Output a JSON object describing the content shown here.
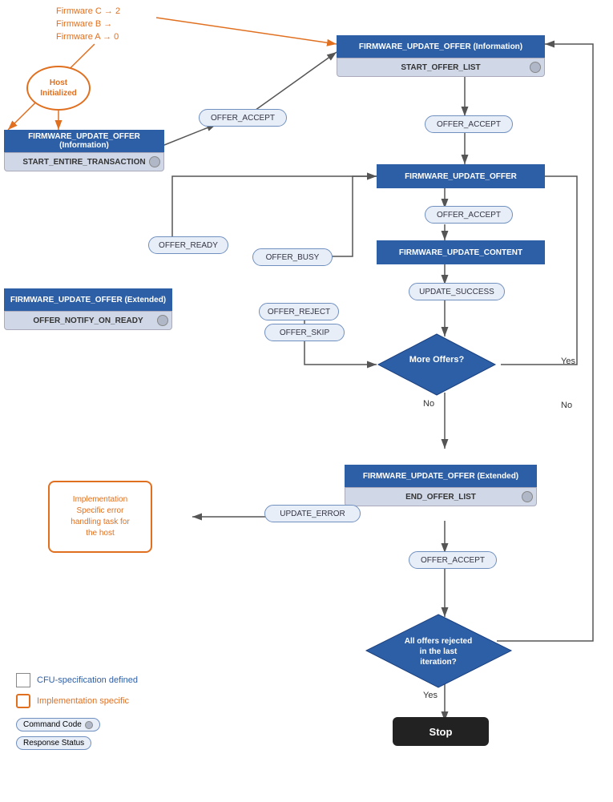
{
  "firmware": {
    "c": "Firmware C → 2",
    "b": "Firmware B →",
    "a": "Firmware A → 0"
  },
  "boxes": {
    "host_initialized": "Host\nInitialized",
    "fw_update_offer_info_top": "FIRMWARE_UPDATE_OFFER (Information)",
    "start_offer_list": "START_OFFER_LIST",
    "fw_update_offer_info_left": "FIRMWARE_UPDATE_OFFER (Information)",
    "start_entire_transaction": "START_ENTIRE_TRANSACTION",
    "fw_update_offer": "FIRMWARE_UPDATE_OFFER",
    "fw_update_content": "FIRMWARE_UPDATE_CONTENT",
    "fw_update_offer_extended_left": "FIRMWARE_UPDATE_OFFER (Extended)",
    "offer_notify_on_ready": "OFFER_NOTIFY_ON_READY",
    "fw_update_offer_extended_bottom": "FIRMWARE_UPDATE_OFFER (Extended)",
    "end_offer_list": "END_OFFER_LIST",
    "stop": "Stop"
  },
  "pills": {
    "offer_accept_top": "OFFER_ACCEPT",
    "offer_accept_mid": "OFFER_ACCEPT",
    "offer_accept_2": "OFFER_ACCEPT",
    "offer_accept_bottom": "OFFER_ACCEPT",
    "offer_ready": "OFFER_READY",
    "offer_busy": "OFFER_BUSY",
    "offer_reject": "OFFER_REJECT",
    "offer_skip": "OFFER_SKIP",
    "update_success": "UPDATE_SUCCESS",
    "update_error": "UPDATE_ERROR"
  },
  "diamonds": {
    "more_offers": "More Offers?",
    "all_offers_rejected": "All offers rejected\nin the last\niteration?"
  },
  "labels": {
    "yes_right": "Yes",
    "no_right": "No",
    "no_bottom": "No",
    "yes_bottom": "Yes"
  },
  "impl_specific": "Implementation\nSpecific error\nhandling task for\nthe host",
  "legend": {
    "cfu_label": "CFU-specification defined",
    "impl_label": "Implementation specific",
    "command_code": "Command Code",
    "response_status": "Response Status"
  }
}
